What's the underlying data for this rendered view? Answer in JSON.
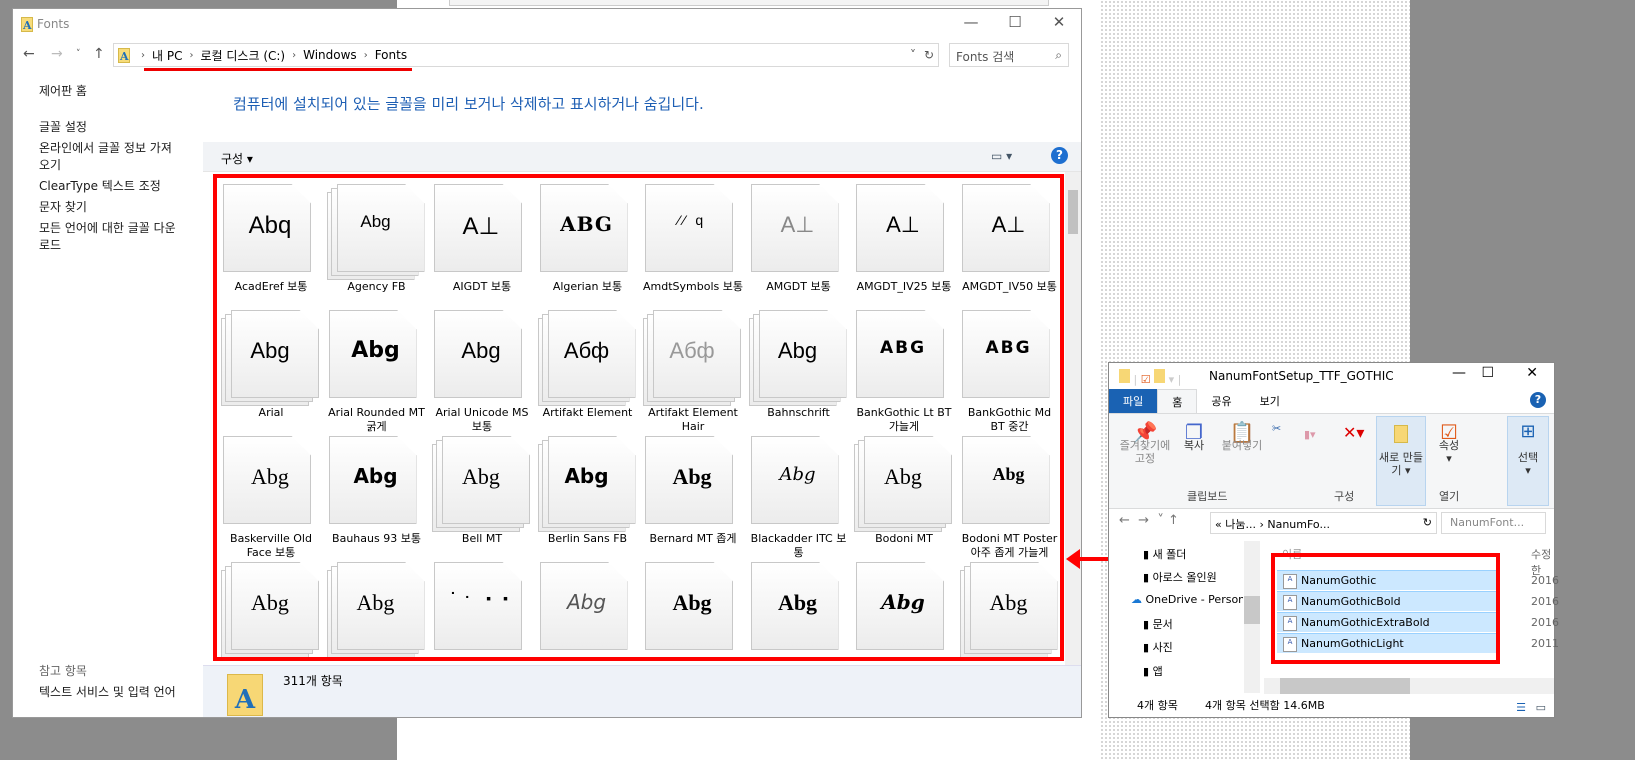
{
  "main_window": {
    "title": "Fonts",
    "breadcrumb": [
      "내 PC",
      "로컬 디스크 (C:)",
      "Windows",
      "Fonts"
    ],
    "search_placeholder": "Fonts 검색",
    "sidebar": {
      "top": "제어판 홈",
      "links": [
        "글꼴 설정",
        "온라인에서 글꼴 정보 가져오기",
        "ClearType 텍스트 조정",
        "문자 찾기",
        "모든 언어에 대한 글꼴 다운로드"
      ],
      "see_also": "참고 항목",
      "see_also_link": "텍스트 서비스 및 입력 언어"
    },
    "heading": "컴퓨터에 설치되어 있는 글꼴을 미리 보거나 삭제하고 표시하거나 숨깁니다.",
    "organize": "구성 ▾",
    "status": "311개 항목",
    "fonts": [
      {
        "sample": "Abq",
        "label": "AcadEref 보통",
        "stacked": false
      },
      {
        "sample": "Abg",
        "label": "Agency FB",
        "stacked": true
      },
      {
        "sample": "A⊥",
        "label": "AIGDT 보통",
        "stacked": false
      },
      {
        "sample": "ABG",
        "label": "Algerian 보통",
        "stacked": false
      },
      {
        "sample": "⁄⁄ q",
        "label": "AmdtSymbols 보통",
        "stacked": false
      },
      {
        "sample": "A⊥",
        "label": "AMGDT 보통",
        "stacked": false
      },
      {
        "sample": "A⊥",
        "label": "AMGDT_IV25 보통",
        "stacked": false
      },
      {
        "sample": "A⊥",
        "label": "AMGDT_IV50 보통",
        "stacked": false
      },
      {
        "sample": "Abg",
        "label": "Arial",
        "stacked": true
      },
      {
        "sample": "Abg",
        "label": "Arial Rounded MT 굵게",
        "stacked": false
      },
      {
        "sample": "Abg",
        "label": "Arial Unicode MS 보통",
        "stacked": false
      },
      {
        "sample": "Абф",
        "label": "Artifakt Element",
        "stacked": true
      },
      {
        "sample": "Абф",
        "label": "Artifakt Element Hair",
        "stacked": true
      },
      {
        "sample": "Abg",
        "label": "Bahnschrift",
        "stacked": true
      },
      {
        "sample": "ABG",
        "label": "BankGothic Lt BT 가늘게",
        "stacked": false
      },
      {
        "sample": "ABG",
        "label": "BankGothic Md BT 중간",
        "stacked": false
      },
      {
        "sample": "Abg",
        "label": "Baskerville Old Face 보통",
        "stacked": false
      },
      {
        "sample": "Abg",
        "label": "Bauhaus 93 보통",
        "stacked": false
      },
      {
        "sample": "Abg",
        "label": "Bell MT",
        "stacked": true
      },
      {
        "sample": "Abg",
        "label": "Berlin Sans FB",
        "stacked": true
      },
      {
        "sample": "Abg",
        "label": "Bernard MT 좁게",
        "stacked": false
      },
      {
        "sample": "Abg",
        "label": "Blackadder ITC 보통",
        "stacked": false
      },
      {
        "sample": "Abg",
        "label": "Bodoni MT",
        "stacked": true
      },
      {
        "sample": "Abg",
        "label": "Bodoni MT Poster 아주 좁게 가늘게",
        "stacked": false
      },
      {
        "sample": "Abg",
        "label": "",
        "stacked": true
      },
      {
        "sample": "Abg",
        "label": "",
        "stacked": true
      },
      {
        "sample": "⠁⠂ ▪ ▪",
        "label": "",
        "stacked": false
      },
      {
        "sample": "Abg",
        "label": "",
        "stacked": false
      },
      {
        "sample": "Abg",
        "label": "",
        "stacked": false
      },
      {
        "sample": "Abg",
        "label": "",
        "stacked": false
      },
      {
        "sample": "Abg",
        "label": "",
        "stacked": false
      },
      {
        "sample": "Abg",
        "label": "",
        "stacked": true
      }
    ]
  },
  "second_window": {
    "title": "NanumFontSetup_TTF_GOTHIC",
    "tabs": [
      "파일",
      "홈",
      "공유",
      "보기"
    ],
    "ribbon": {
      "pin": "즐겨찾기에 고정",
      "copy": "복사",
      "paste": "붙여넣기",
      "clipboard": "클립보드",
      "organize": "구성",
      "new": "새로 만들기",
      "properties": "속성",
      "open": "열기",
      "select": "선택"
    },
    "address": "« 나눔... › NanumFo...",
    "search_placeholder": "NanumFont...",
    "nav": [
      "새 폴더",
      "아로스 올인원",
      "OneDrive - Personal",
      "문서",
      "사진",
      "앱"
    ],
    "col_name": "이름",
    "col_date": "수정한",
    "files": [
      {
        "name": "NanumGothic",
        "date": "2016"
      },
      {
        "name": "NanumGothicBold",
        "date": "2016"
      },
      {
        "name": "NanumGothicExtraBold",
        "date": "2016"
      },
      {
        "name": "NanumGothicLight",
        "date": "2011"
      }
    ],
    "status": "4개 항목",
    "selection": "4개 항목 선택함 14.6MB"
  }
}
